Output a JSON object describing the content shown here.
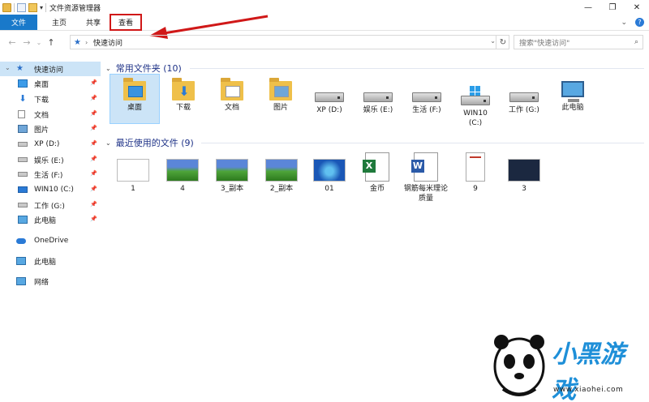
{
  "window": {
    "title": "文件资源管理器",
    "min_glyph": "—",
    "max_glyph": "❐",
    "close_glyph": "✕"
  },
  "ribbon": {
    "tabs": [
      "文件",
      "主页",
      "共享",
      "查看"
    ],
    "expand_glyph": "⌄",
    "help_glyph": "?"
  },
  "nav": {
    "back_glyph": "←",
    "forward_glyph": "→",
    "recent_glyph": "⌄",
    "up_glyph": "↑",
    "path_chevron": "›",
    "path": "快速访问",
    "search_placeholder": "搜索\"快速访问\""
  },
  "sidebar": {
    "quick_access": "快速访问",
    "items": [
      {
        "label": "桌面",
        "icon": "desktop-icon"
      },
      {
        "label": "下载",
        "icon": "download-icon"
      },
      {
        "label": "文档",
        "icon": "document-icon"
      },
      {
        "label": "图片",
        "icon": "picture-icon"
      },
      {
        "label": "XP (D:)",
        "icon": "drive-icon"
      },
      {
        "label": "娱乐 (E:)",
        "icon": "drive-icon"
      },
      {
        "label": "生活 (F:)",
        "icon": "drive-icon"
      },
      {
        "label": "WIN10 (C:)",
        "icon": "windows-drive-icon"
      },
      {
        "label": "工作 (G:)",
        "icon": "drive-icon"
      },
      {
        "label": "此电脑",
        "icon": "computer-icon"
      }
    ],
    "onedrive": "OneDrive",
    "this_pc": "此电脑",
    "network": "网络"
  },
  "frequent": {
    "header": "常用文件夹 (10)",
    "items": [
      "桌面",
      "下载",
      "文档",
      "图片",
      "XP (D:)",
      "娱乐 (E:)",
      "生活 (F:)",
      "WIN10\n(C:)",
      "工作 (G:)",
      "此电脑"
    ]
  },
  "recent": {
    "header": "最近使用的文件 (9)",
    "items": [
      "1",
      "4",
      "3_副本",
      "2_副本",
      "01",
      "金币",
      "钢筋每米理论质量",
      "9",
      "3"
    ]
  },
  "watermark": {
    "brand": "小黑游戏",
    "url": "www.xiaohei.com"
  },
  "colors": {
    "accent": "#1979ca",
    "highlight": "#d01818",
    "selection": "#cce4f7",
    "group_header": "#1e3287"
  }
}
